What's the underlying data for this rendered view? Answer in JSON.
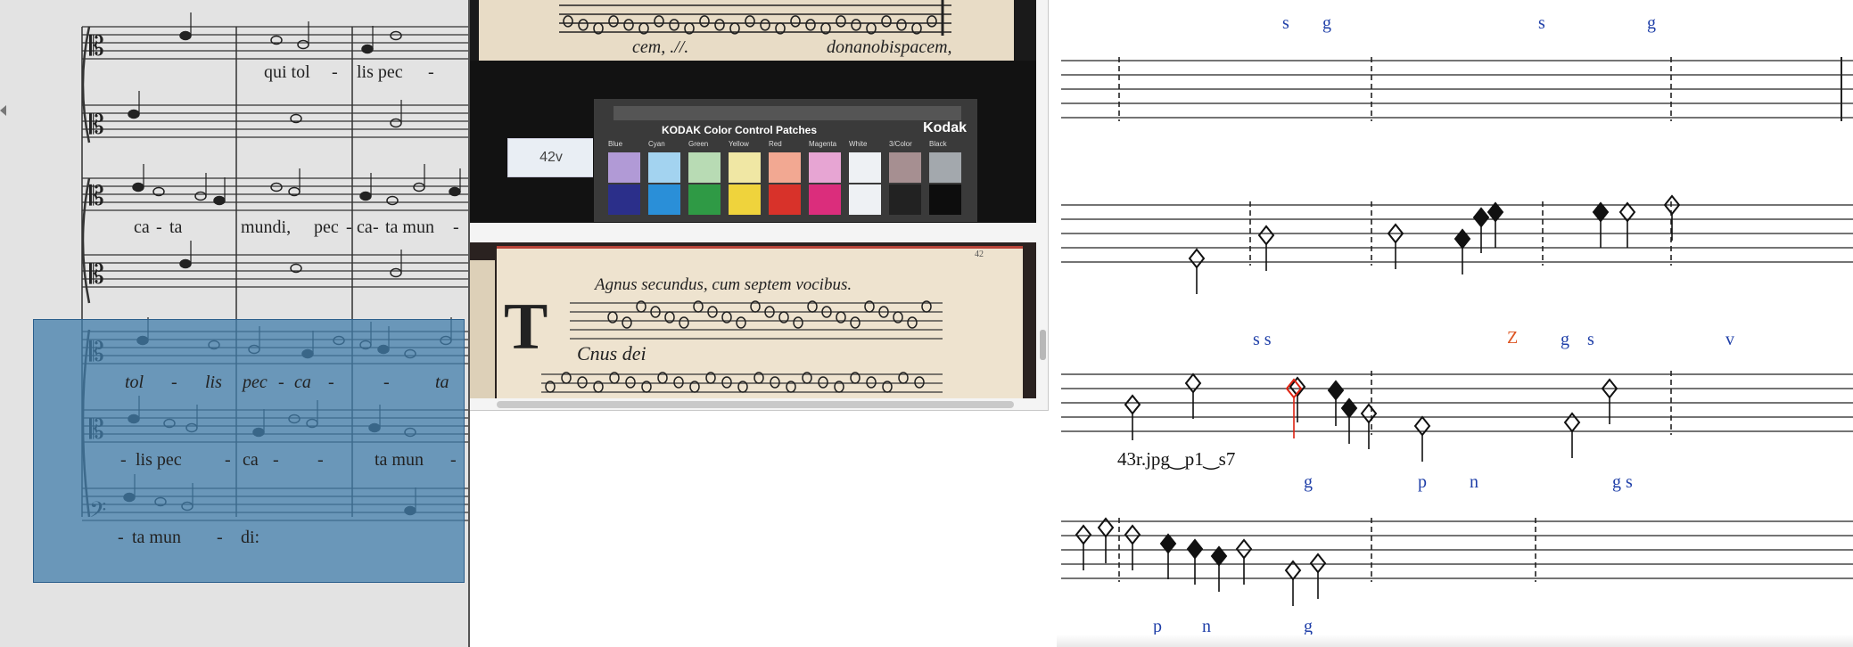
{
  "score": {
    "lyrics": {
      "staff1": [
        "qui tol",
        "-",
        "lis pec",
        "-"
      ],
      "staff3": [
        "ca",
        "-",
        "ta",
        "mundi,",
        "pec",
        "-",
        "ca",
        "-",
        "ta mun",
        "-"
      ],
      "staff5": [
        "tol",
        "-",
        "lis",
        "pec",
        "-",
        "ca",
        "-",
        "-",
        "ta"
      ],
      "staff6": [
        "-",
        "lis pec",
        "-",
        "ca",
        "-",
        "-",
        "ta mun",
        "-"
      ],
      "staff7": [
        "-",
        "ta mun",
        "-",
        "di:"
      ]
    }
  },
  "manuscript": {
    "folio_label": "42v",
    "top_text_left": "cem, .//.",
    "top_text_right": "donanobispacem,",
    "page_number": "42",
    "kodak": {
      "title": "KODAK Color Control Patches",
      "brand": "Kodak",
      "patches": [
        {
          "label": "Blue",
          "top": "#b19ad6",
          "bottom": "#2b2f8a"
        },
        {
          "label": "Cyan",
          "top": "#a3d3f0",
          "bottom": "#2a8fd8"
        },
        {
          "label": "Green",
          "top": "#b8dbb4",
          "bottom": "#2f9a45"
        },
        {
          "label": "Yellow",
          "top": "#f0e7a4",
          "bottom": "#efd33c"
        },
        {
          "label": "Red",
          "top": "#f2a892",
          "bottom": "#d8322a"
        },
        {
          "label": "Magenta",
          "top": "#e7a5d3",
          "bottom": "#db2d7c"
        },
        {
          "label": "White",
          "top": "#eef1f4",
          "bottom": "#eef1f4"
        },
        {
          "label": "3/Color",
          "top": "#a68f91",
          "bottom": "#222222"
        },
        {
          "label": "Black",
          "top": "#a3a8ad",
          "bottom": "#0d0d0d"
        }
      ]
    },
    "heading": "Agnus secundus, cum septem vocibus.",
    "text_line": "Cnus dei"
  },
  "transcription": {
    "file_label": "43r.jpg‿p1‿s7",
    "tags": {
      "row1": [
        "s",
        "g",
        "s",
        "g"
      ],
      "row3": [
        "s s",
        "Z",
        "g",
        "s",
        "v"
      ],
      "row4": [
        "g",
        "p",
        "n",
        "g s"
      ],
      "row5": [
        "p",
        "n",
        "g"
      ]
    },
    "colors": {
      "tag": "#1f3fa8",
      "alert": "#dd5522",
      "alert_note": "#dd2211"
    }
  }
}
